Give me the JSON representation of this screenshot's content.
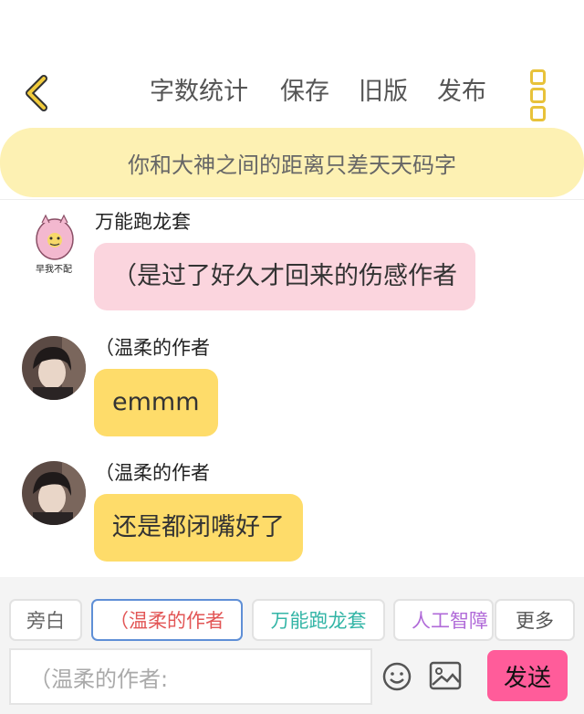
{
  "header": {
    "actions": [
      "字数统计",
      "保存",
      "旧版",
      "发布"
    ],
    "back_icon": "chevron-left-icon",
    "more_icon": "vertical-dots-icon",
    "accent": "#e8c23a"
  },
  "banner": {
    "text": "你和大神之间的距离只差天天码字",
    "bg": "#fdf1b3"
  },
  "messages": [
    {
      "sender": "万能跑龙套",
      "text": "（是过了好久才回来的伤感作者",
      "style": "pink",
      "avatar_caption": "早我不配"
    },
    {
      "sender": "（温柔的作者",
      "text": "emmm",
      "style": "yellow"
    },
    {
      "sender": "（温柔的作者",
      "text": "还是都闭嘴好了",
      "style": "yellow"
    }
  ],
  "roles": [
    {
      "label": "旁白",
      "color": "#666666"
    },
    {
      "label": "（温柔的作者",
      "color": "#e25555"
    },
    {
      "label": "万能跑龙套",
      "color": "#33b5a6"
    },
    {
      "label": "人工智障",
      "color": "#b06ad8"
    },
    {
      "label": "更多",
      "color": "#555555"
    }
  ],
  "composer": {
    "placeholder": "（温柔的作者:",
    "emoji_icon": "smiley-icon",
    "image_icon": "image-icon",
    "send_label": "发送",
    "send_color": "#ff5c9a"
  }
}
